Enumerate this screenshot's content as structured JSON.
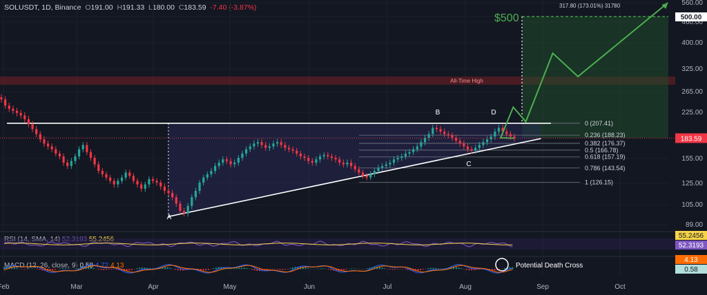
{
  "header": {
    "symbol": "SOLUSDT, 1D, Binance",
    "open_label": "O",
    "open": "191.00",
    "high_label": "H",
    "high": "191.33",
    "low_label": "L",
    "low": "180.00",
    "close_label": "C",
    "close": "183.59",
    "change": "-7.40 (-3.87%)"
  },
  "colors": {
    "background": "#131722",
    "up": "#26a69a",
    "down": "#f23645",
    "target": "#4caf50",
    "price_tag": "#f23645",
    "rsi": "#7e57c2",
    "rsi_sma": "#f7d448",
    "macd": "#2962ff",
    "signal": "#ff6d00"
  },
  "chart_data": {
    "type": "candlestick",
    "price_axis_ticks": [
      "560.00",
      "500.00",
      "460.00",
      "400.00",
      "325.00",
      "265.00",
      "225.00",
      "185.00",
      "155.00",
      "125.00",
      "105.00",
      "89.00"
    ],
    "time_axis_ticks": [
      "Feb",
      "Mar",
      "Apr",
      "May",
      "Jun",
      "Jul",
      "Aug",
      "Sep",
      "Oct"
    ],
    "current_price": "183.59",
    "target_price_tag": "500.00",
    "target_label": "$500",
    "projection_stats": "317.80 (173.01%) 31780",
    "all_time_high_label": "All-Time High",
    "pattern_points": [
      "A",
      "B",
      "C",
      "D"
    ],
    "fib_levels": [
      {
        "ratio": "0",
        "price": 207.41,
        "label": "0 (207.41)"
      },
      {
        "ratio": "0.236",
        "price": 188.23,
        "label": "0.236 (188.23)"
      },
      {
        "ratio": "0.382",
        "price": 176.37,
        "label": "0.382 (176.37)"
      },
      {
        "ratio": "0.5",
        "price": 166.78,
        "label": "0.5 (166.78)"
      },
      {
        "ratio": "0.618",
        "price": 157.19,
        "label": "0.618 (157.19)"
      },
      {
        "ratio": "0.786",
        "price": 143.54,
        "label": "0.786 (143.54)"
      },
      {
        "ratio": "1",
        "price": 126.15,
        "label": "1 (126.15)"
      }
    ],
    "resistance_price": 207.41,
    "support_line": {
      "start": [
        "Apr 07",
        95.5
      ],
      "end": [
        "Aug 31",
        183
      ]
    },
    "projection_path": [
      [
        "Aug 15",
        184
      ],
      [
        "Aug 20",
        235
      ],
      [
        "Aug 25",
        210
      ],
      [
        "Sep 05",
        370
      ],
      [
        "Sep 15",
        305
      ],
      [
        "Oct 20",
        560
      ]
    ],
    "closes_sampled": [
      250,
      238,
      232,
      228,
      224,
      220,
      214,
      206,
      198,
      190,
      182,
      176,
      172,
      168,
      162,
      158,
      150,
      146,
      152,
      158,
      168,
      174,
      164,
      156,
      148,
      140,
      136,
      132,
      128,
      124,
      128,
      132,
      138,
      134,
      128,
      124,
      120,
      124,
      130,
      128,
      126,
      122,
      118,
      116,
      112,
      106,
      100,
      98,
      104,
      112,
      118,
      126,
      132,
      136,
      140,
      146,
      150,
      154,
      152,
      148,
      150,
      156,
      162,
      168,
      172,
      176,
      178,
      174,
      170,
      172,
      176,
      178,
      174,
      170,
      168,
      166,
      162,
      158,
      156,
      152,
      150,
      154,
      158,
      160,
      158,
      156,
      154,
      150,
      148,
      150,
      146,
      142,
      138,
      134,
      132,
      136,
      140,
      144,
      146,
      148,
      150,
      154,
      156,
      158,
      162,
      164,
      168,
      172,
      178,
      184,
      190,
      200,
      198,
      194,
      190,
      188,
      184,
      180,
      176,
      172,
      168,
      166,
      170,
      174,
      178,
      182,
      186,
      194,
      200,
      194,
      190,
      186,
      183.59
    ],
    "rsi": {
      "title": "RSI (14, SMA, 14)",
      "value": "52.3193",
      "sma_value": "55.2456",
      "axis_tags": [
        "55.2456",
        "52.3193"
      ]
    },
    "macd": {
      "title": "MACD (12, 26, close, 9)",
      "values": [
        "0.58",
        "4.72",
        "4.13"
      ],
      "axis_tags": [
        "4.13",
        "0.58"
      ],
      "annotation": "Potential Death Cross"
    }
  }
}
